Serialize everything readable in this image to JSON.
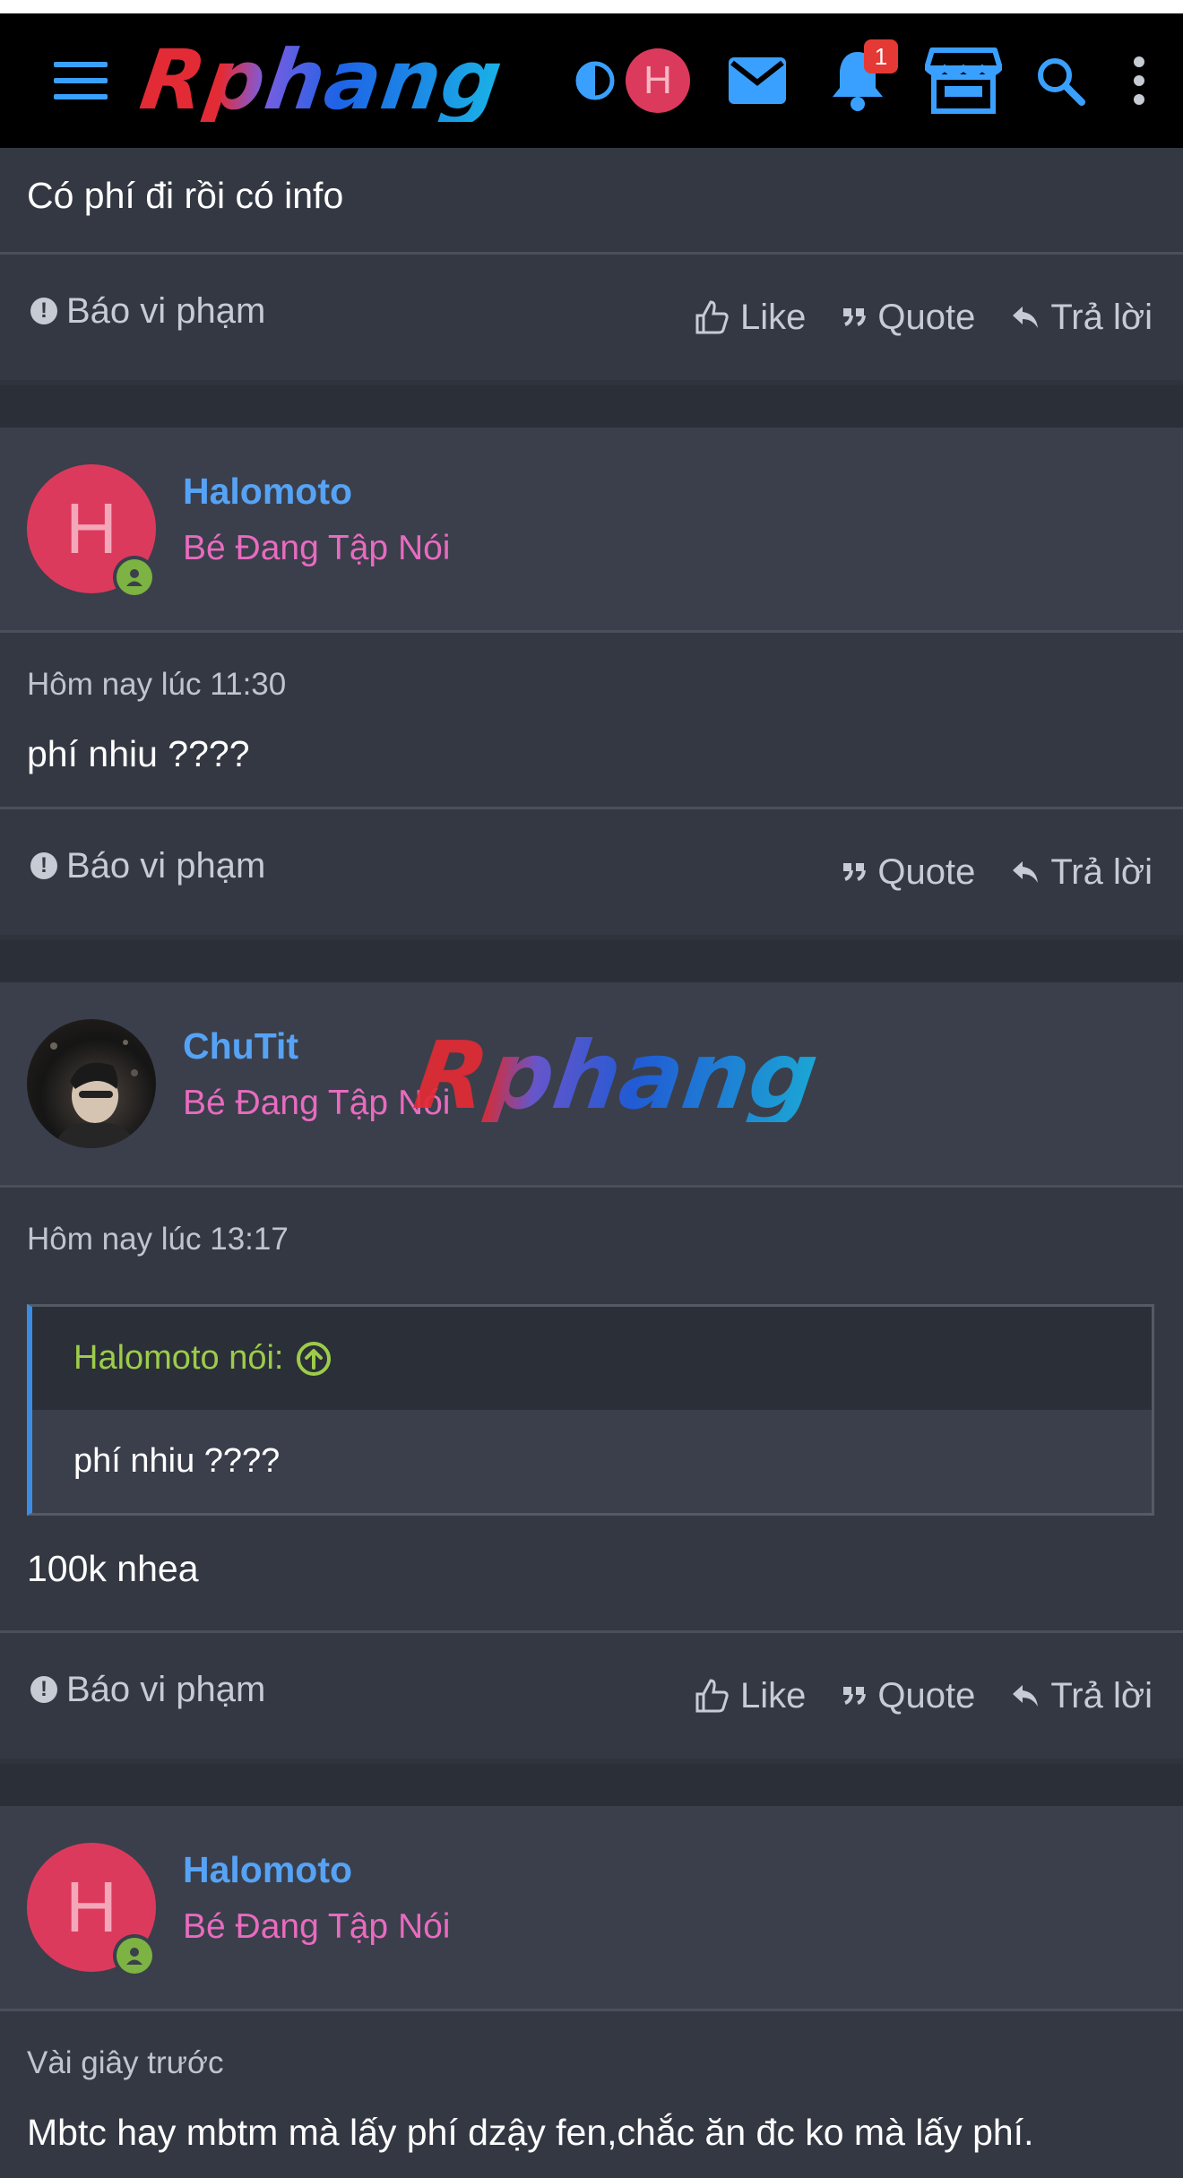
{
  "navbar": {
    "logo": "Rphang",
    "avatar_letter": "H",
    "notification_count": "1",
    "icons": [
      "menu-icon",
      "contrast-icon",
      "mail-icon",
      "bell-icon",
      "store-icon",
      "search-icon",
      "more-vertical-icon"
    ],
    "accent": "#3aa0ff"
  },
  "actions": {
    "report": "Báo vi phạm",
    "like": "Like",
    "quote": "Quote",
    "reply": "Trả lời"
  },
  "posts": [
    {
      "message": "Có phí đi rồi có info"
    },
    {
      "username": "Halomoto",
      "user_title": "Bé Đang Tập Nói",
      "avatar_letter": "H",
      "date": "Hôm nay lúc 11:30",
      "message": "phí nhiu ????"
    },
    {
      "username": "ChuTit",
      "user_title": "Bé Đang Tập Nói",
      "date": "Hôm nay lúc 13:17",
      "quote_author": "Halomoto nói:",
      "quote_text": "phí nhiu ????",
      "message": "100k nhea"
    },
    {
      "username": "Halomoto",
      "user_title": "Bé Đang Tập Nói",
      "avatar_letter": "H",
      "date": "Vài giây trước",
      "message": "Mbtc hay mbtm mà lấy phí dzậy fen,chắc ăn đc ko mà lấy phí."
    }
  ],
  "watermark": "Rphang",
  "colors": {
    "username": "#56a3f5",
    "user_title": "#e86bbf",
    "avatar_bg": "#dc3a5d",
    "online": "#7cb342",
    "quote_author": "#9ccc4a"
  }
}
